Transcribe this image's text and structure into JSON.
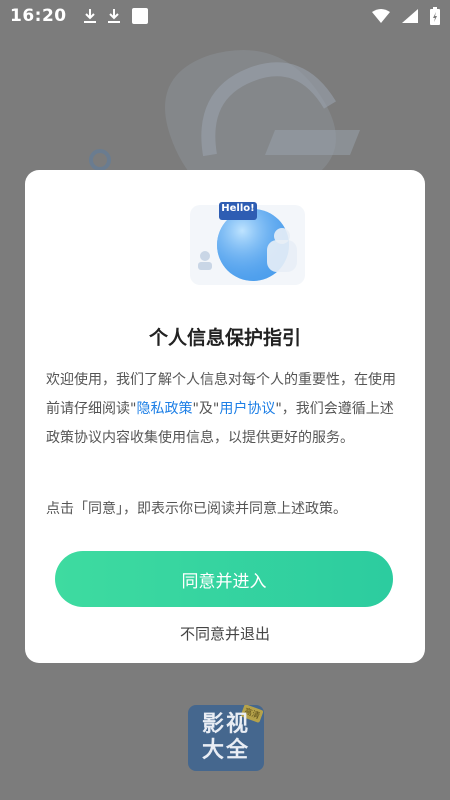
{
  "status_bar": {
    "time": "16:20",
    "left_icons": [
      "download-icon",
      "download-icon",
      "notification-square-icon"
    ],
    "right_icons": [
      "wifi-icon",
      "signal-icon",
      "battery-charging-icon"
    ]
  },
  "dialog": {
    "illustration_text": "Hello!",
    "title": "个人信息保护指引",
    "body_part1": "欢迎使用，我们了解个人信息对每个人的重要性，在使用前请仔细阅读\"",
    "privacy_link": "隐私政策",
    "body_part2": "\"及\"",
    "agreement_link": "用户协议",
    "body_part3": "\"，我们会遵循上述政策协议内容收集使用信息，以提供更好的服务。",
    "note": "点击「同意」，即表示你已阅读并同意上述政策。",
    "agree_label": "同意并进入",
    "disagree_label": "不同意并退出"
  },
  "splash": {
    "logo_line1": "影视",
    "logo_line2": "大全",
    "logo_tag": "高清"
  },
  "colors": {
    "accent_green": "#2fd6a0",
    "link_blue": "#1d7fe6",
    "overlay_gray": "#7c7c7c"
  }
}
